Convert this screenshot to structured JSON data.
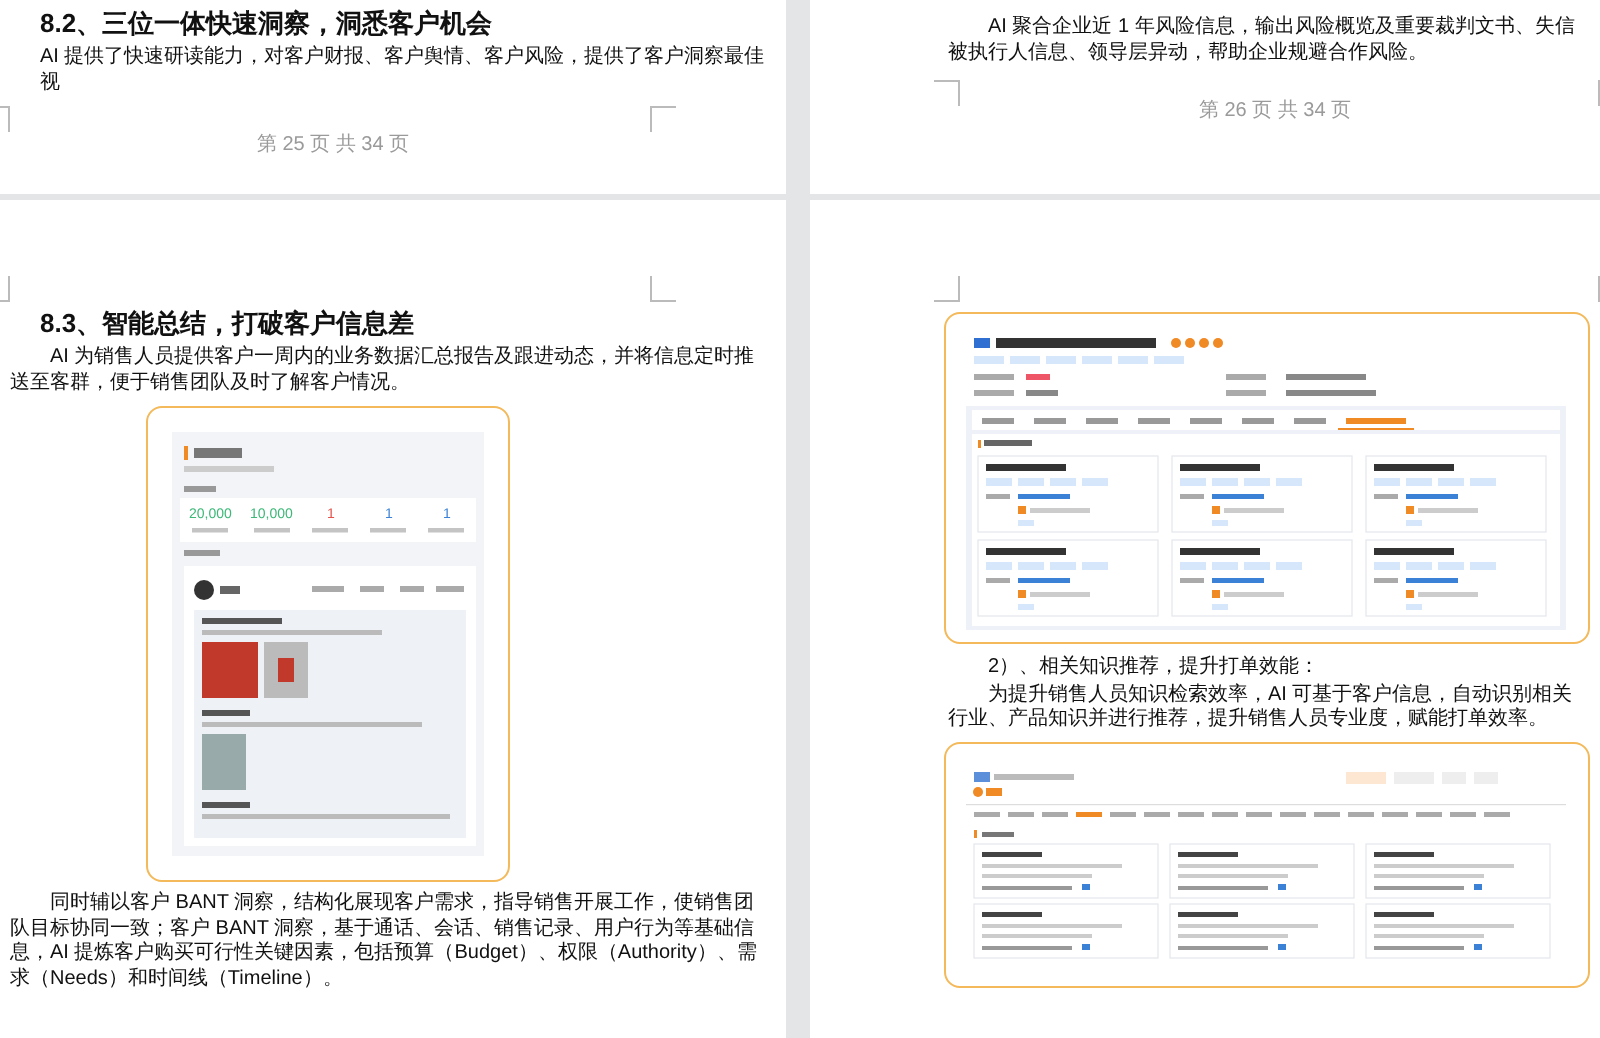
{
  "page_25": {
    "heading": "8.2、三位一体快速洞察，洞悉客户机会",
    "paragraph": "AI 提供了快速研读能力，对客户财报、客户舆情、客户风险，提供了客户洞察最佳视",
    "footer": "第 25 页 共 34 页"
  },
  "page_26": {
    "paragraph": "AI 聚合企业近 1 年风险信息，输出风险概览及重要裁判文书、失信被执行人信息、领导层异动，帮助企业规避合作风险。",
    "footer": "第 26 页 共 34 页"
  },
  "page_27": {
    "heading": "8.3、智能总结，打破客户信息差",
    "paragraph_1": "AI 为销售人员提供客户一周内的业务数据汇总报告及跟进动态，并将信息定时推送至客群，便于销售团队及时了解客户情况。",
    "screenshot": {
      "stats": [
        {
          "value": "20,000",
          "color": "#3cb878"
        },
        {
          "value": "10,000",
          "color": "#3cb878"
        },
        {
          "value": "1",
          "color": "#e5534b"
        },
        {
          "value": "1",
          "color": "#3b82d6"
        },
        {
          "value": "1",
          "color": "#3b82d6"
        }
      ]
    },
    "paragraph_2": "同时辅以客户 BANT 洞察，结构化展现客户需求，指导销售开展工作，使销售团队目标协同一致；客户 BANT 洞察，基于通话、会话、销售记录、用户行为等基础信息，AI 提炼客户购买可行性关键因素，包括预算（Budget）、权限（Authority）、需求（Needs）和时间线（Timeline）。"
  },
  "page_28": {
    "subheading": "2）、相关知识推荐，提升打单效能：",
    "paragraph": "为提升销售人员知识检索效率，AI 可基于客户信息，自动识别相关行业、产品知识并进行推荐，提升销售人员专业度，赋能打单效率。"
  }
}
